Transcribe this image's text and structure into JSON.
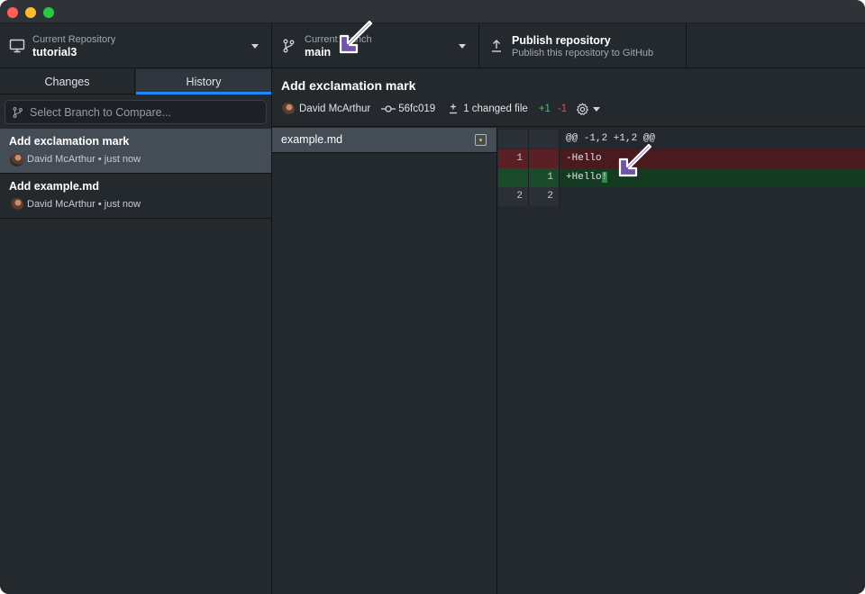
{
  "toolbar": {
    "repository": {
      "title": "Current Repository",
      "value": "tutorial3"
    },
    "branch": {
      "title": "Current Branch",
      "value": "main"
    },
    "publish": {
      "title": "Publish repository",
      "subtitle": "Publish this repository to GitHub"
    }
  },
  "sidebar": {
    "tabs": [
      {
        "label": "Changes"
      },
      {
        "label": "History",
        "active": true
      }
    ],
    "compare_placeholder": "Select Branch to Compare...",
    "commits": [
      {
        "title": "Add exclamation mark",
        "author": "David McArthur",
        "time": "just now",
        "meta": "David McArthur • just now",
        "selected": true
      },
      {
        "title": "Add example.md",
        "author": "David McArthur",
        "time": "just now",
        "meta": "David McArthur • just now",
        "selected": false
      }
    ]
  },
  "commit": {
    "title": "Add exclamation mark",
    "author": "David McArthur",
    "sha": "56fc019",
    "changed_files": "1 changed file",
    "additions": "+1",
    "deletions": "-1"
  },
  "files": [
    {
      "name": "example.md",
      "status": "modified"
    }
  ],
  "diff": {
    "hunk_header": "@@ -1,2 +1,2 @@",
    "lines": [
      {
        "type": "del",
        "old": "1",
        "new": "",
        "text": "-Hello"
      },
      {
        "type": "add",
        "old": "",
        "new": "1",
        "text": "+Hello",
        "highlight": "!"
      },
      {
        "type": "ctx",
        "old": "2",
        "new": "2",
        "text": ""
      }
    ]
  },
  "colors": {
    "accent": "#2188ff",
    "addition": "#34d058",
    "deletion": "#ea4a5a",
    "modified_badge": "#e3b341",
    "annotation_arrow": "#6f54a8"
  }
}
